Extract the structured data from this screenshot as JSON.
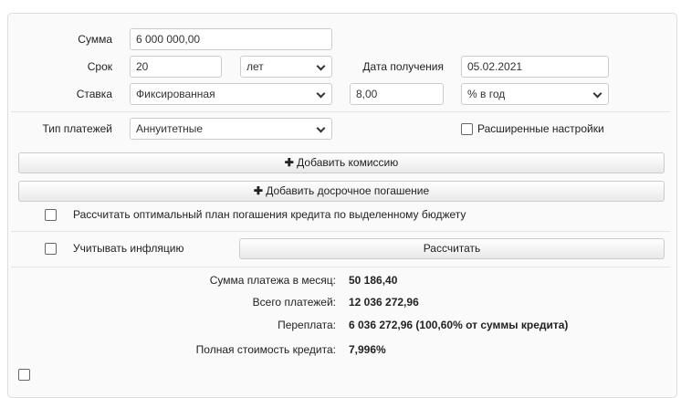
{
  "form": {
    "amount_label": "Сумма",
    "amount_value": "6 000 000,00",
    "term_label": "Срок",
    "term_value": "20",
    "term_unit": "лет",
    "date_label": "Дата получения",
    "date_value": "05.02.2021",
    "rate_label": "Ставка",
    "rate_type": "Фиксированная",
    "rate_value": "8,00",
    "rate_unit": "% в год",
    "payment_type_label": "Тип платежей",
    "payment_type": "Аннуитетные",
    "advanced_label": "Расширенные настройки",
    "add_commission": "Добавить комиссию",
    "add_prepayment": "Добавить досрочное погашение",
    "optimal_plan_label": "Рассчитать оптимальный план погашения кредита по выделенному бюджету",
    "inflation_label": "Учитывать инфляцию",
    "calculate": "Рассчитать"
  },
  "results": [
    {
      "label": "Сумма платежа в месяц:",
      "value": "50 186,40"
    },
    {
      "label": "Всего платежей:",
      "value": "12 036 272,96"
    },
    {
      "label": "Переплата:",
      "value": "6 036 272,96 (100,60% от суммы кредита)"
    },
    {
      "label": "Полная стоимость кредита:",
      "value": "7,996%"
    }
  ]
}
